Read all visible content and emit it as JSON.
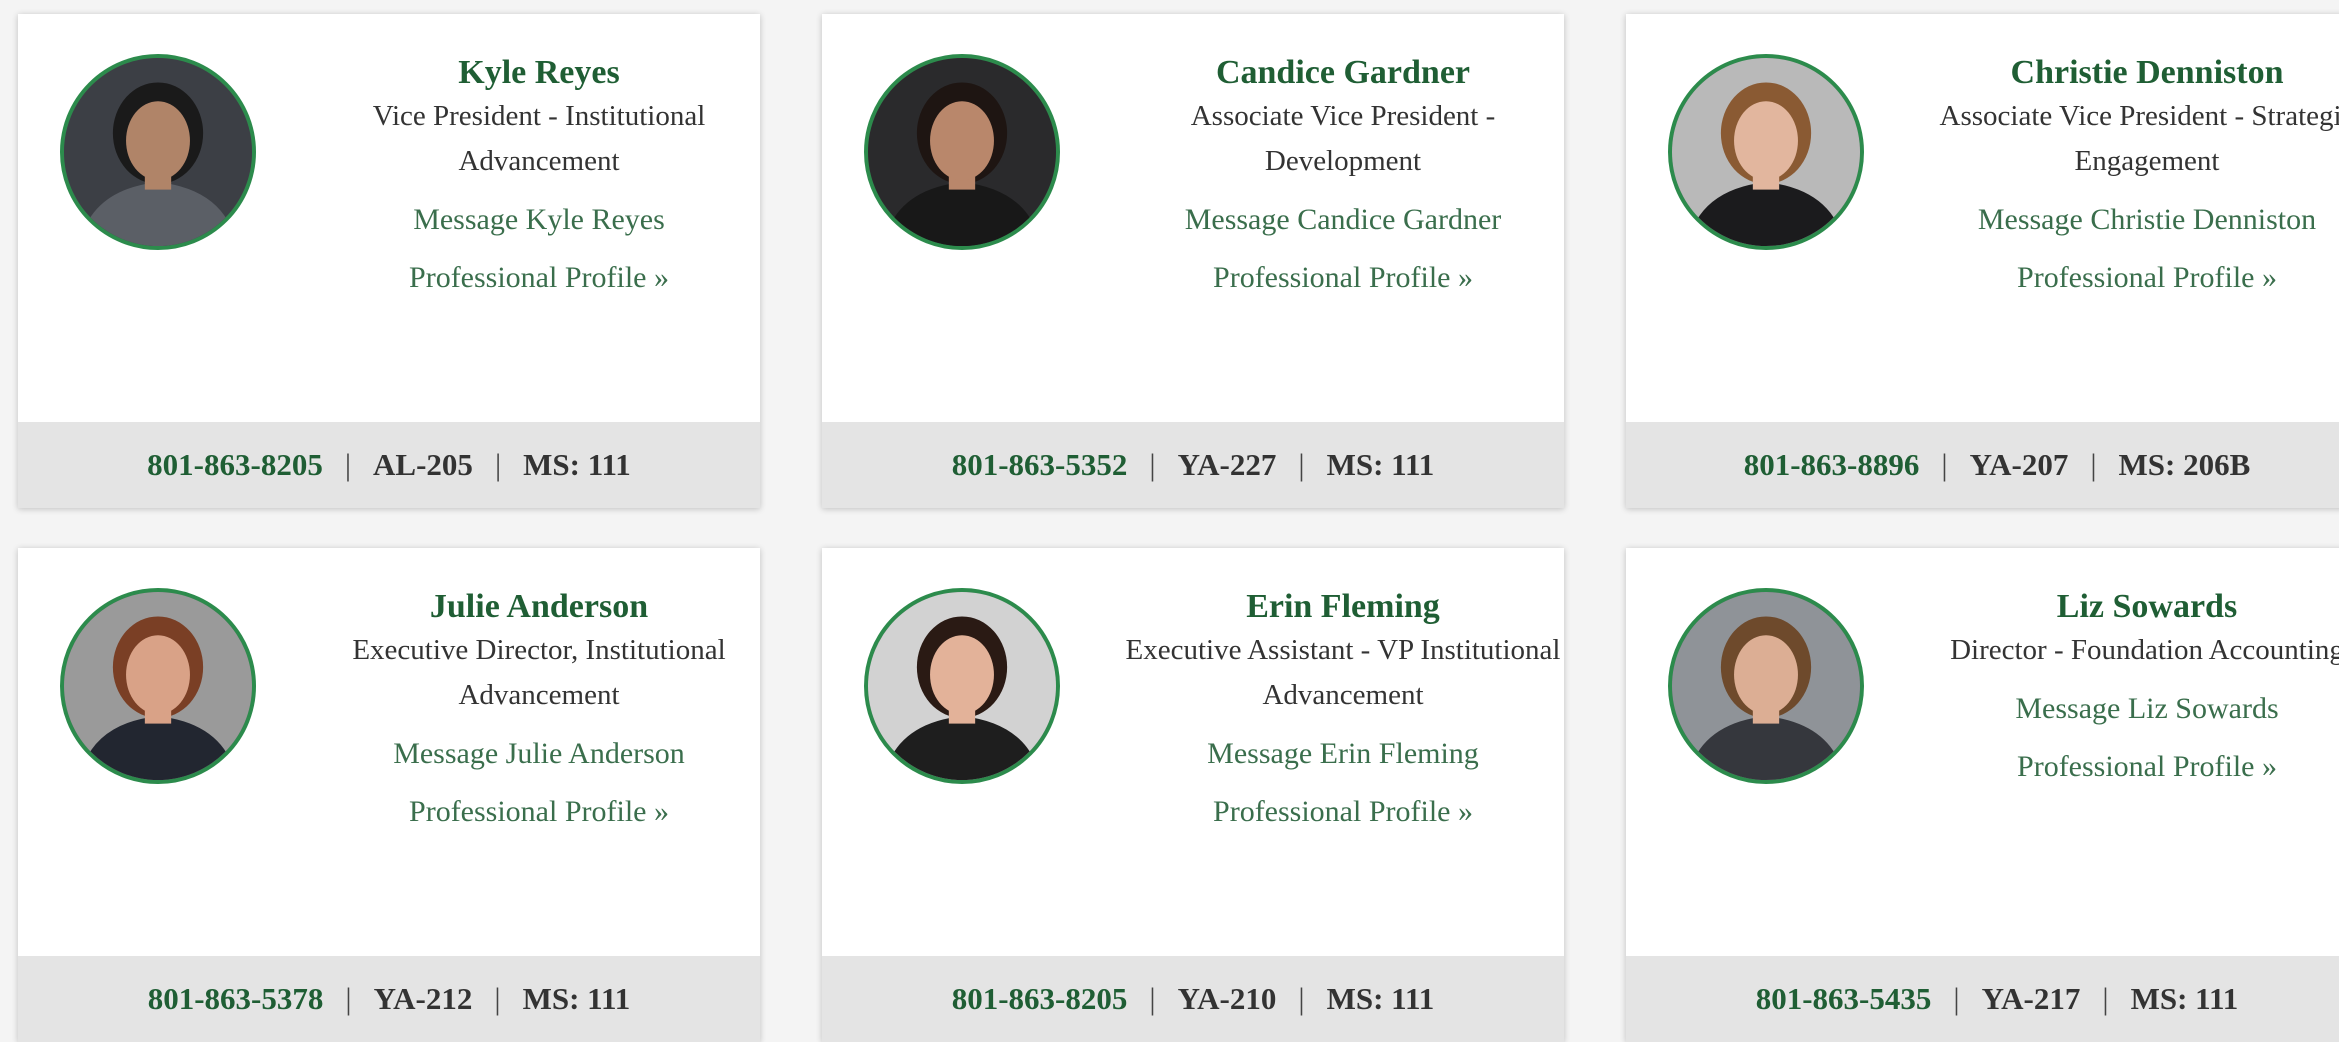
{
  "staff": [
    {
      "name": "Kyle Reyes",
      "title": "Vice President - Institutional Advancement",
      "message_label": "Message Kyle Reyes",
      "profile_label": "Professional Profile",
      "profile_chevron": "»",
      "phone": "801-863-8205",
      "room": "AL-205",
      "mailstop": "MS: 111",
      "photo_bg": "#3c3f45",
      "photo_skin": "#b08468",
      "photo_hair": "#1a1a1a",
      "photo_clothes": "#5b5f66"
    },
    {
      "name": "Candice Gardner",
      "title": "Associate Vice President - Development",
      "message_label": "Message Candice Gardner",
      "profile_label": "Professional Profile",
      "profile_chevron": "»",
      "phone": "801-863-5352",
      "room": "YA-227",
      "mailstop": "MS: 111",
      "photo_bg": "#2a2a2c",
      "photo_skin": "#b9876b",
      "photo_hair": "#1e1512",
      "photo_clothes": "#181818"
    },
    {
      "name": "Christie Denniston",
      "title": "Associate Vice President - Strategic Engagement",
      "message_label": "Message Christie Denniston",
      "profile_label": "Professional Profile",
      "profile_chevron": "»",
      "phone": "801-863-8896",
      "room": "YA-207",
      "mailstop": "MS: 206B",
      "photo_bg": "#b9b9b9",
      "photo_skin": "#e2b69e",
      "photo_hair": "#8a5a33",
      "photo_clothes": "#1b1b1d"
    },
    {
      "name": "Julie Anderson",
      "title": "Executive Director, Institutional Advancement",
      "message_label": "Message Julie Anderson",
      "profile_label": "Professional Profile",
      "profile_chevron": "»",
      "phone": "801-863-5378",
      "room": "YA-212",
      "mailstop": "MS: 111",
      "photo_bg": "#9a9a9a",
      "photo_skin": "#d9a287",
      "photo_hair": "#7a3f25",
      "photo_clothes": "#222630"
    },
    {
      "name": "Erin Fleming",
      "title": "Executive Assistant - VP Institutional Advancement",
      "message_label": "Message Erin Fleming",
      "profile_label": "Professional Profile",
      "profile_chevron": "»",
      "phone": "801-863-8205",
      "room": "YA-210",
      "mailstop": "MS: 111",
      "photo_bg": "#d2d2d2",
      "photo_skin": "#e3b299",
      "photo_hair": "#2a1a14",
      "photo_clothes": "#1e1e1e"
    },
    {
      "name": "Liz Sowards",
      "title": "Director - Foundation Accounting",
      "message_label": "Message Liz Sowards",
      "profile_label": "Professional Profile",
      "profile_chevron": "»",
      "phone": "801-863-5435",
      "room": "YA-217",
      "mailstop": "MS: 111",
      "photo_bg": "#8f9398",
      "photo_skin": "#dcae94",
      "photo_hair": "#6e4a2c",
      "photo_clothes": "#35373d"
    }
  ],
  "colors": {
    "name_green": "#1f5e34",
    "link_green": "#3a6e4c",
    "ring_green": "#2c8b4c",
    "footer_bg": "#e4e4e4"
  }
}
